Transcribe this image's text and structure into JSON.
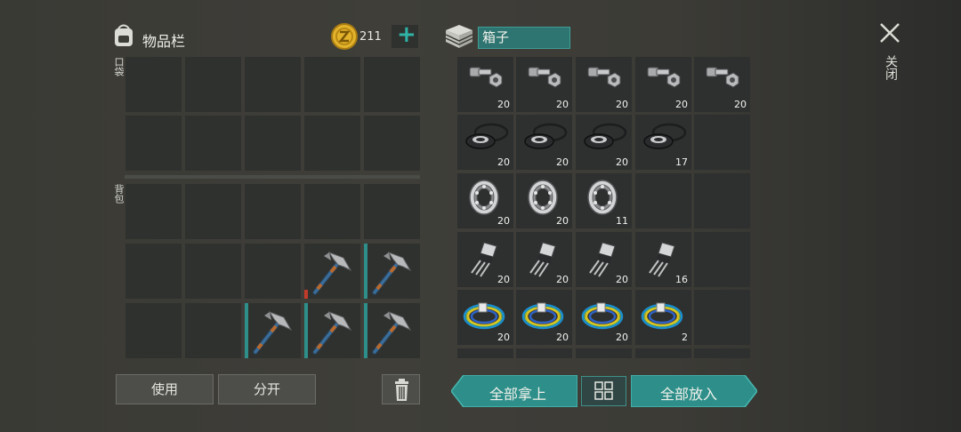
{
  "inventory": {
    "title": "物品栏",
    "coins": "211",
    "plus": "+",
    "pocket_label": "口袋",
    "backpack_label": "背包",
    "use_label": "使用",
    "split_label": "分开"
  },
  "box": {
    "title": "箱子",
    "take_all_label": "全部拿上",
    "put_all_label": "全部放入"
  },
  "close_label": "关闭",
  "right_items": {
    "bolt": [
      "20",
      "20",
      "20",
      "20",
      "20"
    ],
    "gasket": [
      "20",
      "20",
      "20",
      "17"
    ],
    "bearing": [
      "20",
      "20",
      "11"
    ],
    "transistor": [
      "20",
      "20",
      "20",
      "16"
    ],
    "wire": [
      "20",
      "20",
      "20",
      "2"
    ]
  },
  "colors": {
    "accent": "#2e8f8a",
    "accent_light": "#3aaba3",
    "coin": "#e3b32c"
  }
}
